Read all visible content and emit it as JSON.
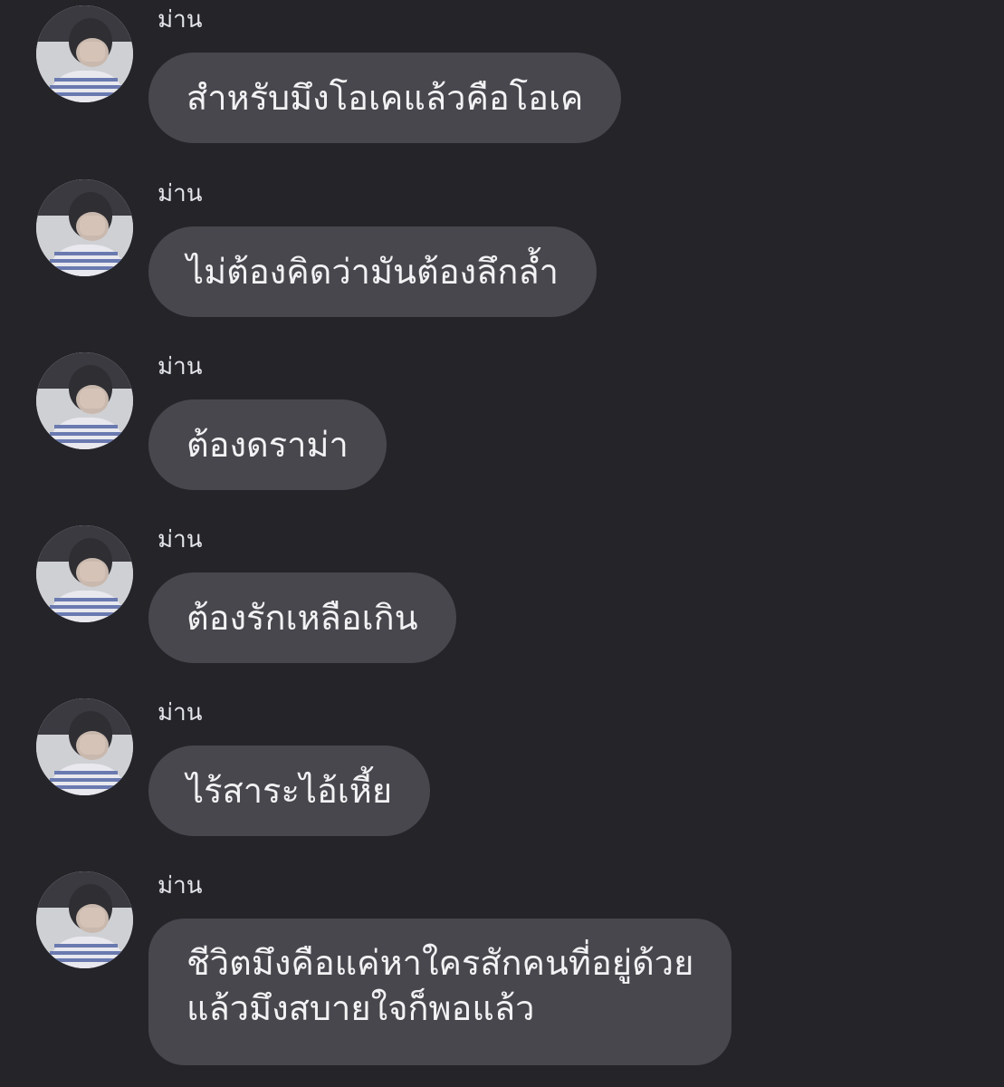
{
  "sender_name": "ม่าน",
  "avatar_icon": "profile-photo-icon",
  "colors": {
    "background": "#242429",
    "bubble": "#47474d",
    "text": "#f2f2f4"
  },
  "messages": [
    {
      "sender": "ม่าน",
      "lines": [
        "สำหรับมึงโอเคแล้วคือโอเค"
      ]
    },
    {
      "sender": "ม่าน",
      "lines": [
        "ไม่ต้องคิดว่ามันต้องลึกล้ำ"
      ]
    },
    {
      "sender": "ม่าน",
      "lines": [
        "ต้องดราม่า"
      ]
    },
    {
      "sender": "ม่าน",
      "lines": [
        "ต้องรักเหลือเกิน"
      ]
    },
    {
      "sender": "ม่าน",
      "lines": [
        "ไร้สาระไอ้เหี้ย"
      ]
    },
    {
      "sender": "ม่าน",
      "lines": [
        "ชีวิตมึงคือแค่หาใครสักคนที่อยู่ด้วย",
        "แล้วมึงสบายใจก็พอแล้ว"
      ]
    }
  ]
}
